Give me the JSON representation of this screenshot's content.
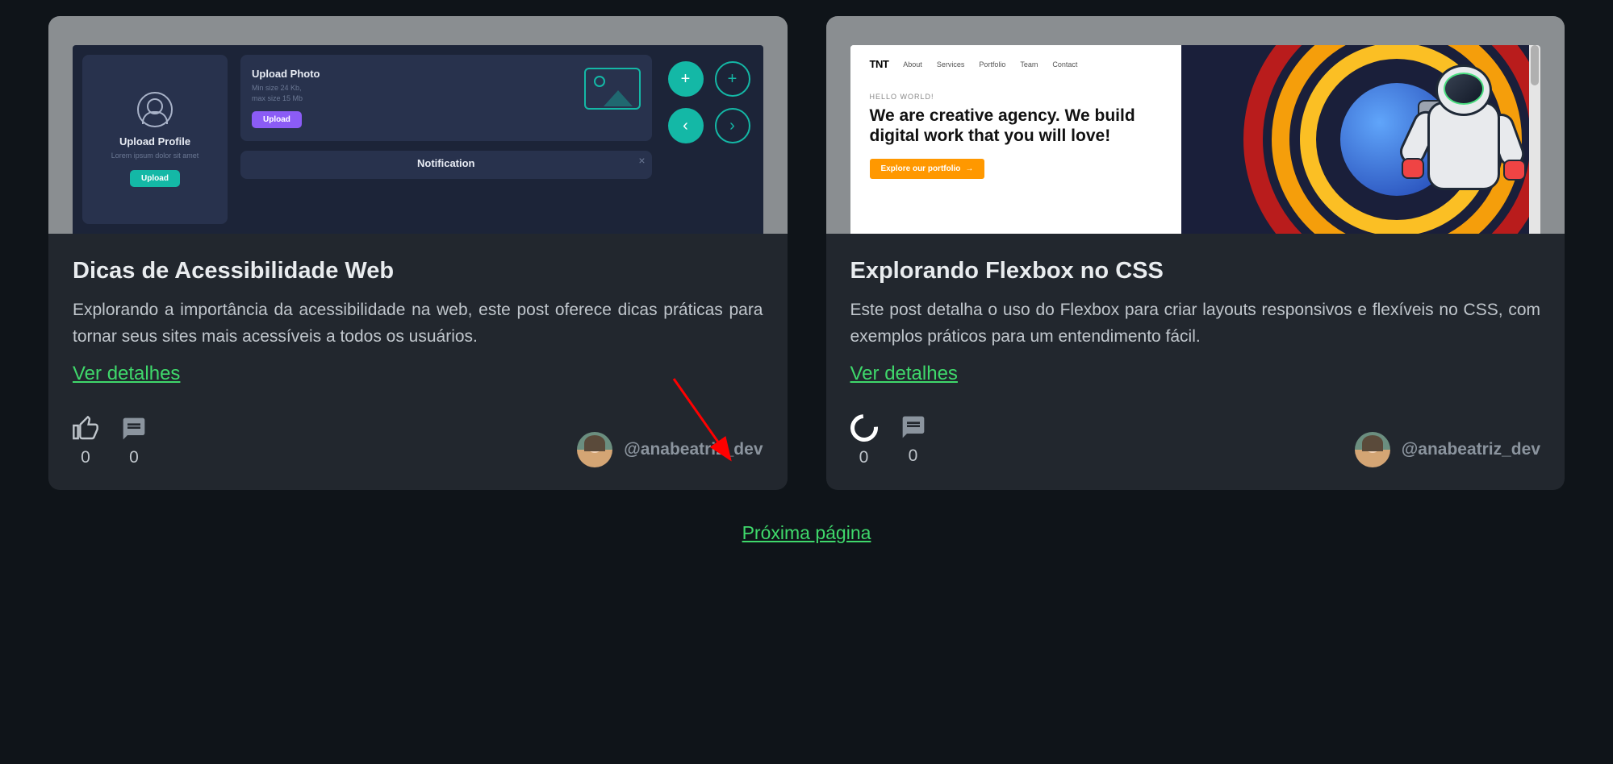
{
  "cards": [
    {
      "title": "Dicas de Acessibilidade Web",
      "description": "Explorando a importância da acessibilidade na web, este post oferece dicas práticas para tornar seus sites mais acessíveis a todos os usuários.",
      "details_link": "Ver detalhes",
      "likes": "0",
      "comments": "0",
      "author_handle": "@anabeatriz_dev",
      "like_state": "thumb",
      "image_mock": {
        "upload_profile_title": "Upload Profile",
        "upload_profile_sub": "Lorem ipsum dolor sit amet",
        "upload_photo_title": "Upload Photo",
        "upload_photo_sub1": "Min size 24 Kb,",
        "upload_photo_sub2": "max size 15 Mb",
        "upload_btn": "Upload",
        "notification_title": "Notification"
      }
    },
    {
      "title": "Explorando Flexbox no CSS",
      "description": "Este post detalha o uso do Flexbox para criar layouts responsivos e flexíveis no CSS, com exemplos práticos para um entendimento fácil.",
      "details_link": "Ver detalhes",
      "likes": "0",
      "comments": "0",
      "author_handle": "@anabeatriz_dev",
      "like_state": "spinner",
      "image_mock": {
        "logo": "TNT",
        "nav": [
          "About",
          "Services",
          "Portfolio",
          "Team",
          "Contact"
        ],
        "hello": "HELLO WORLD!",
        "headline": "We are creative agency. We build digital work that you will love!",
        "cta": "Explore our portfolio",
        "cta_arrow": "→"
      }
    }
  ],
  "next_page_label": "Próxima página",
  "icons": {
    "thumb_up": "thumb-up-icon",
    "comment": "comment-icon",
    "spinner": "loading-spinner-icon"
  }
}
